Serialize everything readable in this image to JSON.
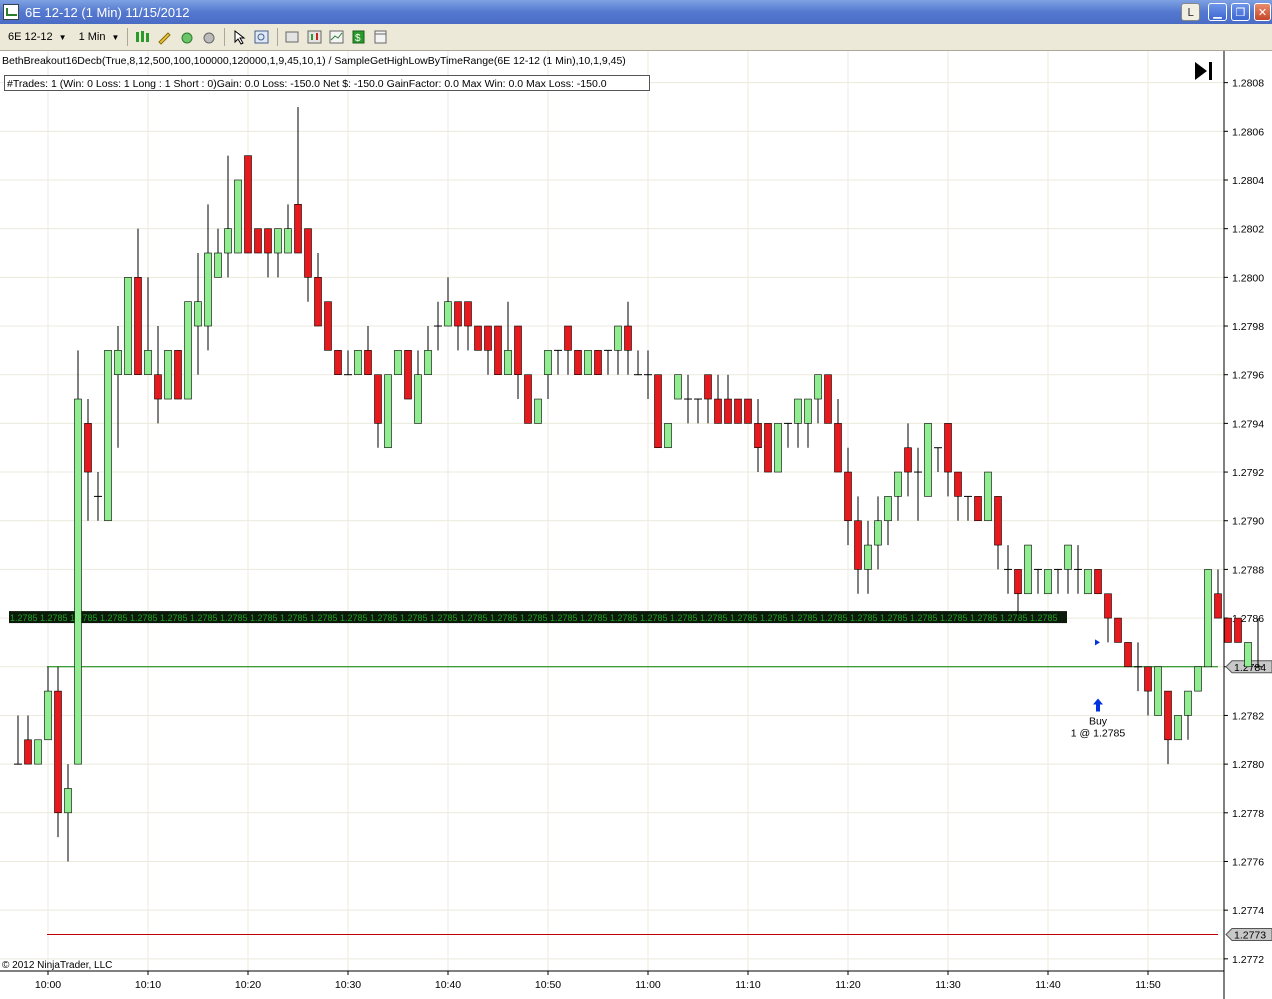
{
  "window": {
    "title": "6E 12-12 (1 Min)  11/15/2012",
    "btn_l": "L",
    "btn_min": "▁",
    "btn_max": "❐",
    "btn_close": "✕"
  },
  "toolbar": {
    "instrument": "6E 12-12",
    "interval": "1 Min"
  },
  "chart": {
    "indicator_line": "BethBreakout16Decb(True,8,12,500,100,100000,120000,1,9,45,10,1) / SampleGetHighLowByTimeRange(6E 12-12 (1 Min),10,1,9,45)",
    "stats_line": "#Trades: 1  (Win: 0  Loss: 1  Long : 1  Short : 0)Gain: 0.0  Loss: -150.0  Net $: -150.0  GainFactor: 0.0  Max  Win: 0.0  Max  Loss: -150.0",
    "copyright": "© 2012 NinjaTrader, LLC",
    "band_label": "1.2785",
    "price_markers": [
      {
        "label": "1.2784",
        "price": 1.2784,
        "color": "#008000"
      },
      {
        "label": "1.2773",
        "price": 1.2773,
        "color": "#c00000"
      }
    ],
    "trade": {
      "label1": "Buy",
      "label2": "1 @ 1.2785"
    }
  },
  "chart_data": {
    "type": "candlestick",
    "y_ticks": [
      "1.2808",
      "1.2806",
      "1.2804",
      "1.2802",
      "1.2800",
      "1.2798",
      "1.2796",
      "1.2794",
      "1.2792",
      "1.2790",
      "1.2788",
      "1.2786",
      "1.2784",
      "1.2782",
      "1.2780",
      "1.2778",
      "1.2776",
      "1.2774",
      "1.2772"
    ],
    "ylim": [
      1.27715,
      1.28093
    ],
    "x_ticks": [
      "10:00",
      "10:10",
      "10:20",
      "10:30",
      "10:40",
      "10:50",
      "11:00",
      "11:10",
      "11:20",
      "11:30",
      "11:40",
      "11:50"
    ],
    "start_label": "09:57",
    "minutes_per_bar": 1,
    "up_color": "#90ee90",
    "down_color": "#e8191d",
    "bars": [
      {
        "o": 1.278,
        "h": 1.2782,
        "l": 1.278,
        "c": 1.278
      },
      {
        "o": 1.2781,
        "h": 1.2782,
        "l": 1.278,
        "c": 1.278
      },
      {
        "o": 1.278,
        "h": 1.2781,
        "l": 1.278,
        "c": 1.2781
      },
      {
        "o": 1.2781,
        "h": 1.2784,
        "l": 1.2781,
        "c": 1.2783
      },
      {
        "o": 1.2783,
        "h": 1.2784,
        "l": 1.2777,
        "c": 1.2778
      },
      {
        "o": 1.2778,
        "h": 1.278,
        "l": 1.2776,
        "c": 1.2779
      },
      {
        "o": 1.278,
        "h": 1.2797,
        "l": 1.278,
        "c": 1.2795
      },
      {
        "o": 1.2794,
        "h": 1.2795,
        "l": 1.279,
        "c": 1.2792
      },
      {
        "o": 1.2791,
        "h": 1.2792,
        "l": 1.279,
        "c": 1.2791
      },
      {
        "o": 1.279,
        "h": 1.2797,
        "l": 1.279,
        "c": 1.2797
      },
      {
        "o": 1.2796,
        "h": 1.2798,
        "l": 1.2793,
        "c": 1.2797
      },
      {
        "o": 1.2796,
        "h": 1.28,
        "l": 1.2796,
        "c": 1.28
      },
      {
        "o": 1.28,
        "h": 1.2802,
        "l": 1.2796,
        "c": 1.2796
      },
      {
        "o": 1.2796,
        "h": 1.28,
        "l": 1.2796,
        "c": 1.2797
      },
      {
        "o": 1.2796,
        "h": 1.2798,
        "l": 1.2794,
        "c": 1.2795
      },
      {
        "o": 1.2795,
        "h": 1.2797,
        "l": 1.2795,
        "c": 1.2797
      },
      {
        "o": 1.2797,
        "h": 1.2797,
        "l": 1.2795,
        "c": 1.2795
      },
      {
        "o": 1.2795,
        "h": 1.2799,
        "l": 1.2795,
        "c": 1.2799
      },
      {
        "o": 1.2798,
        "h": 1.2801,
        "l": 1.2796,
        "c": 1.2799
      },
      {
        "o": 1.2798,
        "h": 1.2803,
        "l": 1.2797,
        "c": 1.2801
      },
      {
        "o": 1.28,
        "h": 1.2802,
        "l": 1.28,
        "c": 1.2801
      },
      {
        "o": 1.2801,
        "h": 1.2805,
        "l": 1.28,
        "c": 1.2802
      },
      {
        "o": 1.2801,
        "h": 1.2804,
        "l": 1.2801,
        "c": 1.2804
      },
      {
        "o": 1.2805,
        "h": 1.2805,
        "l": 1.2801,
        "c": 1.2801
      },
      {
        "o": 1.2802,
        "h": 1.2802,
        "l": 1.2801,
        "c": 1.2801
      },
      {
        "o": 1.2802,
        "h": 1.2802,
        "l": 1.28,
        "c": 1.2801
      },
      {
        "o": 1.2801,
        "h": 1.2802,
        "l": 1.28,
        "c": 1.2802
      },
      {
        "o": 1.2801,
        "h": 1.2803,
        "l": 1.2801,
        "c": 1.2802
      },
      {
        "o": 1.2803,
        "h": 1.2807,
        "l": 1.2801,
        "c": 1.2801
      },
      {
        "o": 1.2802,
        "h": 1.2802,
        "l": 1.2799,
        "c": 1.28
      },
      {
        "o": 1.28,
        "h": 1.2801,
        "l": 1.2799,
        "c": 1.2798
      },
      {
        "o": 1.2799,
        "h": 1.2799,
        "l": 1.2797,
        "c": 1.2797
      },
      {
        "o": 1.2797,
        "h": 1.2797,
        "l": 1.2796,
        "c": 1.2796
      },
      {
        "o": 1.2796,
        "h": 1.2797,
        "l": 1.2796,
        "c": 1.2796
      },
      {
        "o": 1.2796,
        "h": 1.2797,
        "l": 1.2796,
        "c": 1.2797
      },
      {
        "o": 1.2797,
        "h": 1.2798,
        "l": 1.2796,
        "c": 1.2796
      },
      {
        "o": 1.2796,
        "h": 1.2796,
        "l": 1.2793,
        "c": 1.2794
      },
      {
        "o": 1.2793,
        "h": 1.2795,
        "l": 1.2793,
        "c": 1.2796
      },
      {
        "o": 1.2796,
        "h": 1.2797,
        "l": 1.2796,
        "c": 1.2797
      },
      {
        "o": 1.2797,
        "h": 1.2797,
        "l": 1.2795,
        "c": 1.2795
      },
      {
        "o": 1.2794,
        "h": 1.2797,
        "l": 1.2794,
        "c": 1.2796
      },
      {
        "o": 1.2796,
        "h": 1.2798,
        "l": 1.2796,
        "c": 1.2797
      },
      {
        "o": 1.2798,
        "h": 1.2799,
        "l": 1.2797,
        "c": 1.2798
      },
      {
        "o": 1.2798,
        "h": 1.28,
        "l": 1.2798,
        "c": 1.2799
      },
      {
        "o": 1.2799,
        "h": 1.2799,
        "l": 1.2797,
        "c": 1.2798
      },
      {
        "o": 1.2799,
        "h": 1.2799,
        "l": 1.2797,
        "c": 1.2798
      },
      {
        "o": 1.2798,
        "h": 1.2798,
        "l": 1.2797,
        "c": 1.2797
      },
      {
        "o": 1.2798,
        "h": 1.2798,
        "l": 1.2796,
        "c": 1.2797
      },
      {
        "o": 1.2798,
        "h": 1.2798,
        "l": 1.2796,
        "c": 1.2796
      },
      {
        "o": 1.2796,
        "h": 1.2799,
        "l": 1.2796,
        "c": 1.2797
      },
      {
        "o": 1.2798,
        "h": 1.2798,
        "l": 1.2795,
        "c": 1.2796
      },
      {
        "o": 1.2796,
        "h": 1.2796,
        "l": 1.2794,
        "c": 1.2794
      },
      {
        "o": 1.2794,
        "h": 1.2795,
        "l": 1.2794,
        "c": 1.2795
      },
      {
        "o": 1.2796,
        "h": 1.2797,
        "l": 1.2795,
        "c": 1.2797
      },
      {
        "o": 1.2797,
        "h": 1.2797,
        "l": 1.2796,
        "c": 1.2797
      },
      {
        "o": 1.2798,
        "h": 1.2798,
        "l": 1.2796,
        "c": 1.2797
      },
      {
        "o": 1.2797,
        "h": 1.2797,
        "l": 1.2796,
        "c": 1.2796
      },
      {
        "o": 1.2796,
        "h": 1.2797,
        "l": 1.2796,
        "c": 1.2797
      },
      {
        "o": 1.2797,
        "h": 1.2797,
        "l": 1.2796,
        "c": 1.2796
      },
      {
        "o": 1.2797,
        "h": 1.2797,
        "l": 1.2796,
        "c": 1.2797
      },
      {
        "o": 1.2797,
        "h": 1.2798,
        "l": 1.2796,
        "c": 1.2798
      },
      {
        "o": 1.2798,
        "h": 1.2799,
        "l": 1.2796,
        "c": 1.2797
      },
      {
        "o": 1.2796,
        "h": 1.2797,
        "l": 1.2796,
        "c": 1.2796
      },
      {
        "o": 1.2796,
        "h": 1.2797,
        "l": 1.2795,
        "c": 1.2796
      },
      {
        "o": 1.2796,
        "h": 1.2796,
        "l": 1.2793,
        "c": 1.2793
      },
      {
        "o": 1.2793,
        "h": 1.2794,
        "l": 1.2793,
        "c": 1.2794
      },
      {
        "o": 1.2795,
        "h": 1.2796,
        "l": 1.2795,
        "c": 1.2796
      },
      {
        "o": 1.2795,
        "h": 1.2796,
        "l": 1.2794,
        "c": 1.2795
      },
      {
        "o": 1.2795,
        "h": 1.2795,
        "l": 1.2794,
        "c": 1.2795
      },
      {
        "o": 1.2796,
        "h": 1.2796,
        "l": 1.2794,
        "c": 1.2795
      },
      {
        "o": 1.2795,
        "h": 1.2796,
        "l": 1.2794,
        "c": 1.2794
      },
      {
        "o": 1.2795,
        "h": 1.2796,
        "l": 1.2794,
        "c": 1.2794
      },
      {
        "o": 1.2795,
        "h": 1.2795,
        "l": 1.2794,
        "c": 1.2794
      },
      {
        "o": 1.2795,
        "h": 1.2795,
        "l": 1.2794,
        "c": 1.2794
      },
      {
        "o": 1.2794,
        "h": 1.2795,
        "l": 1.2792,
        "c": 1.2793
      },
      {
        "o": 1.2794,
        "h": 1.2794,
        "l": 1.2792,
        "c": 1.2792
      },
      {
        "o": 1.2792,
        "h": 1.2794,
        "l": 1.2792,
        "c": 1.2794
      },
      {
        "o": 1.2794,
        "h": 1.2794,
        "l": 1.2793,
        "c": 1.2794
      },
      {
        "o": 1.2794,
        "h": 1.2795,
        "l": 1.2793,
        "c": 1.2795
      },
      {
        "o": 1.2794,
        "h": 1.2795,
        "l": 1.2793,
        "c": 1.2795
      },
      {
        "o": 1.2795,
        "h": 1.2796,
        "l": 1.2794,
        "c": 1.2796
      },
      {
        "o": 1.2796,
        "h": 1.2796,
        "l": 1.2794,
        "c": 1.2794
      },
      {
        "o": 1.2794,
        "h": 1.2795,
        "l": 1.2792,
        "c": 1.2792
      },
      {
        "o": 1.2792,
        "h": 1.2793,
        "l": 1.2789,
        "c": 1.279
      },
      {
        "o": 1.279,
        "h": 1.2791,
        "l": 1.2787,
        "c": 1.2788
      },
      {
        "o": 1.2788,
        "h": 1.279,
        "l": 1.2787,
        "c": 1.2789
      },
      {
        "o": 1.2789,
        "h": 1.2791,
        "l": 1.2788,
        "c": 1.279
      },
      {
        "o": 1.279,
        "h": 1.2791,
        "l": 1.2789,
        "c": 1.2791
      },
      {
        "o": 1.2791,
        "h": 1.2792,
        "l": 1.279,
        "c": 1.2792
      },
      {
        "o": 1.2793,
        "h": 1.2794,
        "l": 1.2791,
        "c": 1.2792
      },
      {
        "o": 1.2792,
        "h": 1.2793,
        "l": 1.279,
        "c": 1.2792
      },
      {
        "o": 1.2791,
        "h": 1.2794,
        "l": 1.2791,
        "c": 1.2794
      },
      {
        "o": 1.2793,
        "h": 1.2793,
        "l": 1.2792,
        "c": 1.2793
      },
      {
        "o": 1.2794,
        "h": 1.2794,
        "l": 1.2791,
        "c": 1.2792
      },
      {
        "o": 1.2792,
        "h": 1.2792,
        "l": 1.279,
        "c": 1.2791
      },
      {
        "o": 1.2791,
        "h": 1.2791,
        "l": 1.279,
        "c": 1.2791
      },
      {
        "o": 1.2791,
        "h": 1.2791,
        "l": 1.279,
        "c": 1.279
      },
      {
        "o": 1.279,
        "h": 1.2792,
        "l": 1.279,
        "c": 1.2792
      },
      {
        "o": 1.2791,
        "h": 1.2791,
        "l": 1.2788,
        "c": 1.2789
      },
      {
        "o": 1.2788,
        "h": 1.2789,
        "l": 1.2787,
        "c": 1.2788
      },
      {
        "o": 1.2788,
        "h": 1.2788,
        "l": 1.2786,
        "c": 1.2787
      },
      {
        "o": 1.2787,
        "h": 1.2789,
        "l": 1.2787,
        "c": 1.2789
      },
      {
        "o": 1.2788,
        "h": 1.2788,
        "l": 1.2787,
        "c": 1.2788
      },
      {
        "o": 1.2787,
        "h": 1.2788,
        "l": 1.2787,
        "c": 1.2788
      },
      {
        "o": 1.2788,
        "h": 1.2788,
        "l": 1.2787,
        "c": 1.2788
      },
      {
        "o": 1.2788,
        "h": 1.2789,
        "l": 1.2787,
        "c": 1.2789
      },
      {
        "o": 1.2788,
        "h": 1.2789,
        "l": 1.2787,
        "c": 1.2788
      },
      {
        "o": 1.2787,
        "h": 1.2788,
        "l": 1.2787,
        "c": 1.2788
      },
      {
        "o": 1.2788,
        "h": 1.2788,
        "l": 1.2787,
        "c": 1.2787
      },
      {
        "o": 1.2787,
        "h": 1.2787,
        "l": 1.2785,
        "c": 1.2786
      },
      {
        "o": 1.2786,
        "h": 1.2786,
        "l": 1.2785,
        "c": 1.2785
      },
      {
        "o": 1.2785,
        "h": 1.2785,
        "l": 1.2784,
        "c": 1.2784
      },
      {
        "o": 1.2784,
        "h": 1.2785,
        "l": 1.2783,
        "c": 1.2784
      },
      {
        "o": 1.2784,
        "h": 1.2784,
        "l": 1.2782,
        "c": 1.2783
      },
      {
        "o": 1.2782,
        "h": 1.2784,
        "l": 1.2782,
        "c": 1.2784
      },
      {
        "o": 1.2783,
        "h": 1.2783,
        "l": 1.278,
        "c": 1.2781
      },
      {
        "o": 1.2781,
        "h": 1.2782,
        "l": 1.2781,
        "c": 1.2782
      },
      {
        "o": 1.2782,
        "h": 1.2783,
        "l": 1.2781,
        "c": 1.2783
      },
      {
        "o": 1.2783,
        "h": 1.2784,
        "l": 1.2783,
        "c": 1.2784
      },
      {
        "o": 1.2784,
        "h": 1.2788,
        "l": 1.2784,
        "c": 1.2788
      },
      {
        "o": 1.2787,
        "h": 1.2788,
        "l": 1.2786,
        "c": 1.2786
      },
      {
        "o": 1.2786,
        "h": 1.2786,
        "l": 1.2785,
        "c": 1.2785
      },
      {
        "o": 1.2786,
        "h": 1.2786,
        "l": 1.2785,
        "c": 1.2785
      },
      {
        "o": 1.2784,
        "h": 1.2785,
        "l": 1.2784,
        "c": 1.2785
      },
      {
        "o": 1.2784,
        "h": 1.2786,
        "l": 1.2784,
        "c": 1.2784
      }
    ]
  }
}
